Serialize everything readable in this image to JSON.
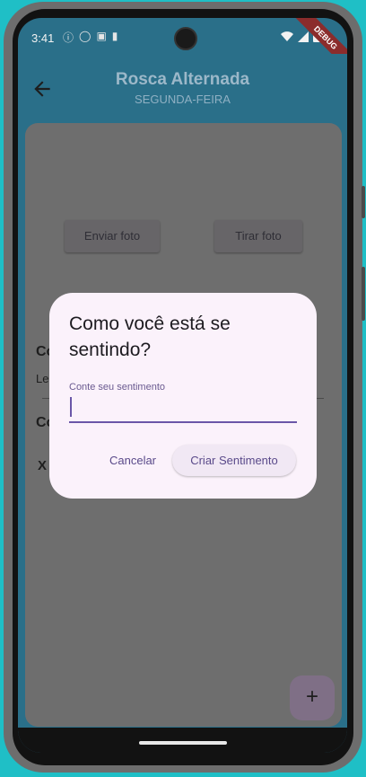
{
  "status_bar": {
    "time": "3:41",
    "debug_banner": "DEBUG"
  },
  "app_bar": {
    "title": "Rosca Alternada",
    "subtitle": "SEGUNDA-FEIRA"
  },
  "body": {
    "send_photo_label": "Enviar foto",
    "take_photo_label": "Tirar foto",
    "section_label_1": "Co",
    "section_text_1": "Le",
    "section_label_2": "Co",
    "section_glyph": "X"
  },
  "fab": {
    "icon": "plus-icon",
    "label": "+"
  },
  "dialog": {
    "title": "Como você está se sentindo?",
    "field_label": "Conte seu sentimento",
    "field_value": "",
    "cancel_label": "Cancelar",
    "confirm_label": "Criar Sentimento"
  },
  "colors": {
    "accent": "#6a56a8",
    "dialog_background": "#fbf2fb",
    "scrim_app_bar": "#2a6f89",
    "debug_banner": "#8b2c2c"
  }
}
